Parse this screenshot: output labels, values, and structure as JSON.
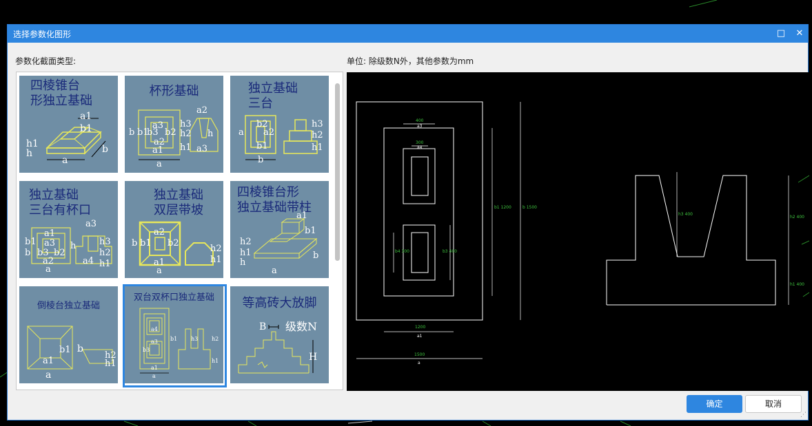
{
  "window": {
    "title": "选择参数化图形",
    "maximize_glyph": "□",
    "close_glyph": "✕"
  },
  "labels": {
    "section_type": "参数化截面类型:",
    "unit_note": "单位:  除级数N外，其他参数为mm"
  },
  "gallery": {
    "selected_index": 7,
    "items": [
      {
        "title_line1": "四棱锥台",
        "title_line2": "形独立基础"
      },
      {
        "title_line1": "杯形基础",
        "title_line2": ""
      },
      {
        "title_line1": "独立基础",
        "title_line2": "三台"
      },
      {
        "title_line1": "独立基础",
        "title_line2": "三台有杯口"
      },
      {
        "title_line1": "独立基础",
        "title_line2": "双层带坡"
      },
      {
        "title_line1": "四棱锥台形",
        "title_line2": "独立基础带柱"
      },
      {
        "title_line1": "倒棱台独立基础",
        "title_line2": ""
      },
      {
        "title_line1": "双台双杯口独立基础",
        "title_line2": ""
      },
      {
        "title_line1": "等高砖大放脚",
        "title_line2": ""
      }
    ],
    "dim_labels": {
      "a": "a",
      "b": "b",
      "a1": "a1",
      "a2": "a2",
      "a3": "a3",
      "a4": "a4",
      "b1": "b1",
      "b2": "b2",
      "b3": "b3",
      "h": "h",
      "h1": "h1",
      "h2": "h2",
      "h3": "h3",
      "B": "B",
      "H": "H",
      "levels": "级数N"
    }
  },
  "preview": {
    "dims": {
      "top_small": "400",
      "top_small_sym": "a3",
      "inner_small": "300",
      "inner_small_sym": "a4",
      "b1_label": "b1 1200",
      "b_label": "b   1500",
      "b3_label": "b3 400",
      "b4_label": "b4 300",
      "a1_value": "1200",
      "a1_sym": "a1",
      "a_value": "1500",
      "a_sym": "a",
      "h3_label": "h3 400",
      "h2_label": "h2 400",
      "h1_label": "h1 400"
    }
  },
  "buttons": {
    "ok": "确定",
    "cancel": "取消"
  },
  "colors": {
    "accent": "#2e86e0",
    "thumb_bg": "#6f8ea5",
    "thumb_title": "#1a2a7a",
    "cad_line": "#ffffff",
    "cad_text": "#3fc43f",
    "sketch_yellow": "#e8e85a"
  }
}
